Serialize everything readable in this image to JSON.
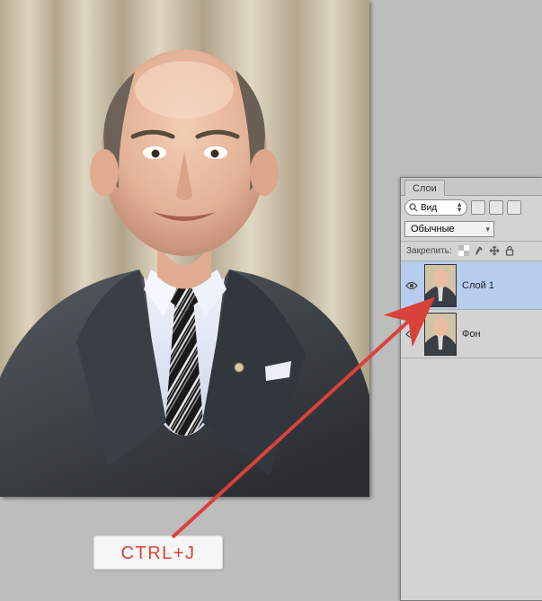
{
  "shortcut": "CTRL+J",
  "panel": {
    "tab_label": "Слои",
    "search_label": "Вид",
    "blend_mode": "Обычные",
    "lock_label": "Закрепить:"
  },
  "layers": [
    {
      "name": "Слой 1",
      "selected": true,
      "visible": true
    },
    {
      "name": "Фон",
      "selected": false,
      "visible": true
    }
  ]
}
